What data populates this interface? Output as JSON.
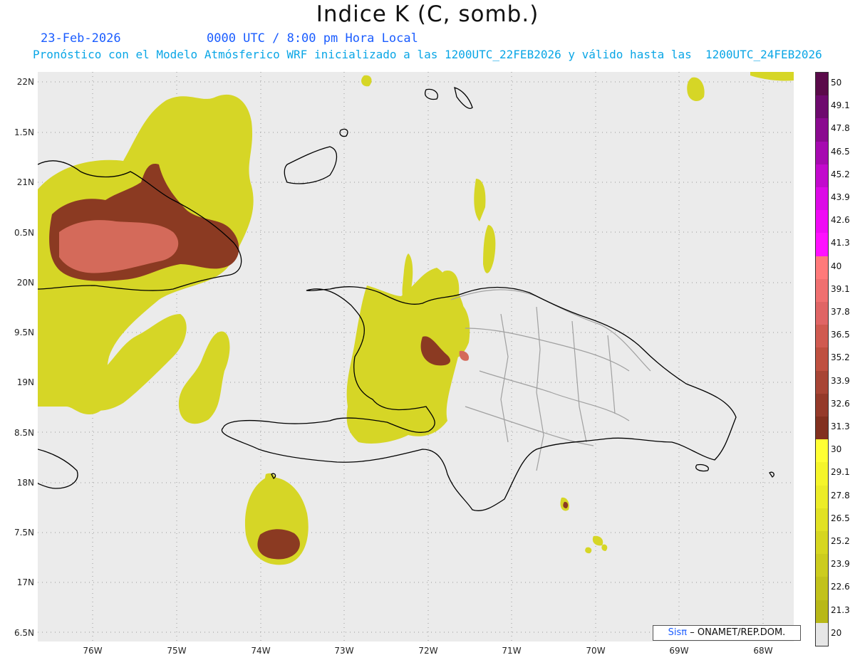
{
  "title": "Indice K (C, somb.)",
  "date": "23-Feb-2026",
  "time": "0000 UTC / 8:00 pm Hora Local",
  "description": "Pronóstico con el Modelo Atmósferico WRF inicializado a las 1200UTC_22FEB2026 y válido hasta las  1200UTC_24FEB2026",
  "lat_labels": [
    "22N",
    "1.5N",
    "21N",
    "0.5N",
    "20N",
    "9.5N",
    "19N",
    "8.5N",
    "18N",
    "7.5N",
    "17N",
    "6.5N"
  ],
  "lon_labels": [
    "76W",
    "75W",
    "74W",
    "73W",
    "72W",
    "71W",
    "70W",
    "69W",
    "68W"
  ],
  "colorbar_labels": [
    "50",
    "49.1",
    "47.8",
    "46.5",
    "45.2",
    "43.9",
    "42.6",
    "41.3",
    "40",
    "39.1",
    "37.8",
    "36.5",
    "35.2",
    "33.9",
    "32.6",
    "31.3",
    "30",
    "29.1",
    "27.8",
    "26.5",
    "25.2",
    "23.9",
    "22.6",
    "21.3",
    "20"
  ],
  "colorbar_colors": [
    "#5a0a4a",
    "#6e0a6e",
    "#8a0a8f",
    "#a60ab0",
    "#c20acd",
    "#dc0ae6",
    "#f00af5",
    "#ff10ff",
    "#ff7a7a",
    "#f07070",
    "#e06565",
    "#d05a50",
    "#bf5040",
    "#a84535",
    "#953a2a",
    "#82301f",
    "#ffff33",
    "#f5f52a",
    "#ecec28",
    "#e1e124",
    "#d6d620",
    "#cccc1e",
    "#c2c21b",
    "#b8b818"
  ],
  "credit_brand": "Sisπ",
  "credit_text": "– ONAMET/REP.DOM.",
  "colors": {
    "background": "#ebebeb",
    "coast": "#000000",
    "provinces": "#a0a0a0",
    "yellow": "#d6d626",
    "brown": "#8b3a22",
    "salmon": "#d46a5a"
  }
}
